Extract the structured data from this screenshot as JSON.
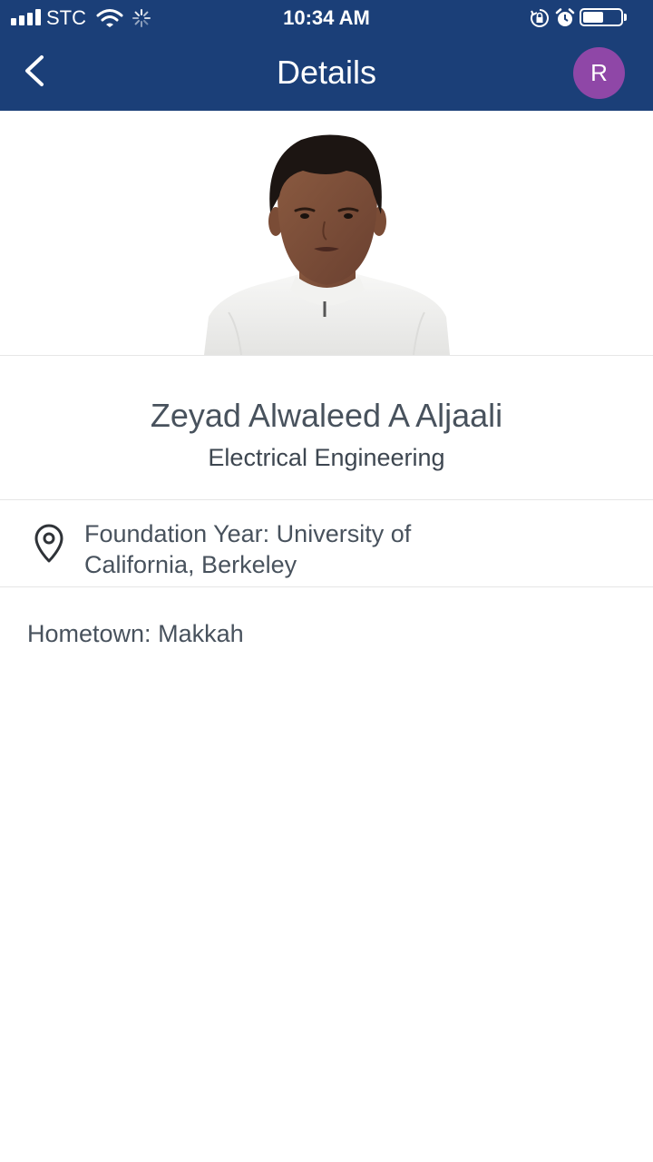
{
  "status_bar": {
    "carrier": "STC",
    "time": "10:34 AM",
    "signal_bars": 4,
    "battery_level": 0.55,
    "icons": [
      "signal-icon",
      "wifi-icon",
      "activity-spinner-icon",
      "rotation-lock-icon",
      "alarm-icon",
      "battery-icon"
    ]
  },
  "header": {
    "title": "Details",
    "back_icon": "chevron-left-icon",
    "avatar_initial": "R",
    "avatar_color": "#8f47a7",
    "background_color": "#1b3f78"
  },
  "profile": {
    "name": "Zeyad Alwaleed A Aljaali",
    "major": "Electrical Engineering",
    "location_icon": "location-pin-icon",
    "foundation_year": "Foundation Year: University of California, Berkeley",
    "hometown_label": "Hometown:",
    "hometown_value": "Makkah"
  }
}
